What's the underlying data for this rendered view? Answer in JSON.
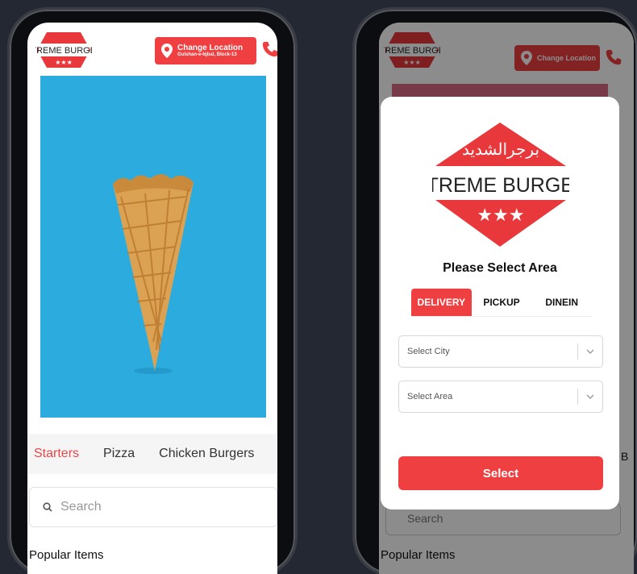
{
  "left_screen": {
    "change_location": {
      "label": "Change Location",
      "sublabel": "Gulshan-e-Iqbal, Block-13"
    },
    "categories": [
      "Starters",
      "Pizza",
      "Chicken Burgers"
    ],
    "search": {
      "placeholder": "Search"
    },
    "section_title": "Popular Items"
  },
  "right_screen": {
    "change_location": {
      "label": "Change Location"
    },
    "modal": {
      "brand_name": "XTREME BURGER",
      "brand_arabic": "برجرالشديد",
      "title": "Please Select Area",
      "tabs": [
        "DELIVERY",
        "PICKUP",
        "DINEIN"
      ],
      "active_tab": "DELIVERY",
      "city_select": {
        "placeholder": "Select City"
      },
      "area_select": {
        "placeholder": "Select Area"
      },
      "select_button": "Select"
    },
    "behind_text": {
      "search_fragment": "Search",
      "popular": "Popular Items",
      "cut_letter": "B"
    }
  },
  "colors": {
    "accent": "#ef3f41",
    "hero_background": "#2cabdf",
    "page_background": "#232833"
  }
}
